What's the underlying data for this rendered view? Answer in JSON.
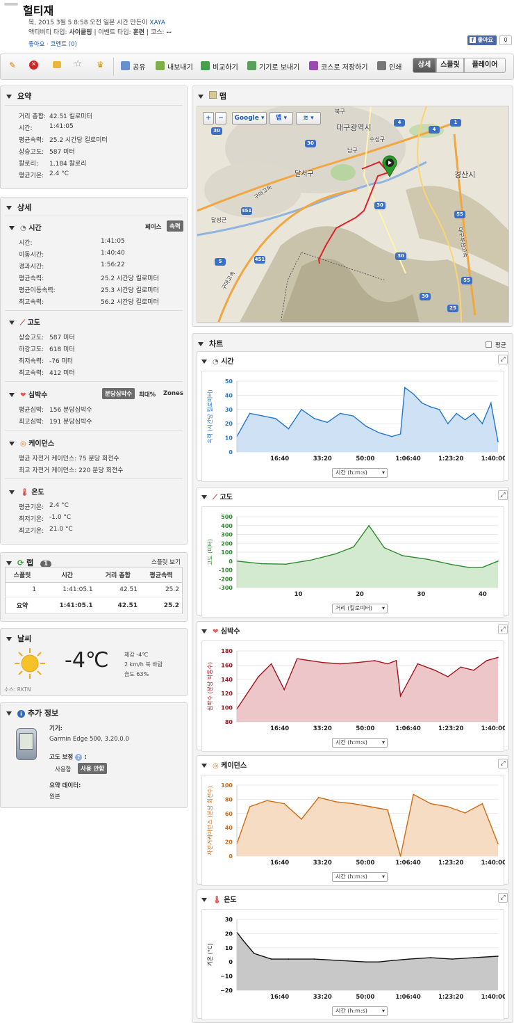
{
  "header": {
    "title": "헐티재",
    "date_line_prefix": "목, 2015 3월 5 8:58 오전 일본 시간 만든이",
    "author": "XAYA",
    "activity_type_label": "액티비티 타입:",
    "activity_type": "사이클링",
    "event_type_label": "| 이벤트 타입:",
    "event_type": "훈련",
    "course_label": "| 코스:",
    "course": "--",
    "like_link": "좋아요",
    "comment_link": "코멘트 (0)",
    "dot": "·",
    "fb_like": "좋아요",
    "fb_count": "0"
  },
  "toolbar": {
    "share": "공유",
    "export": "내보내기",
    "compare": "비교하기",
    "send_to_device": "기기로 보내기",
    "save_course": "코스로 저장하기",
    "print": "인쇄",
    "view_tabs": [
      "상세",
      "스플릿",
      "플레이어"
    ]
  },
  "summary": {
    "title": "요약",
    "rows": [
      {
        "label": "거리 총합:",
        "value": "42.51 킬로미터"
      },
      {
        "label": "시간:",
        "value": "1:41:05"
      },
      {
        "label": "평균속력:",
        "value": "25.2 시간당 킬로미터"
      },
      {
        "label": "상승고도:",
        "value": "587 미터"
      },
      {
        "label": "칼로리:",
        "value": "1,184 칼로리"
      },
      {
        "label": "평균기온:",
        "value": "2.4 °C"
      }
    ]
  },
  "details": {
    "title": "상세",
    "time": {
      "title": "시간",
      "toggle": [
        "페이스",
        "속력"
      ],
      "rows": [
        {
          "label": "시간:",
          "value": "1:41:05"
        },
        {
          "label": "이동시간:",
          "value": "1:40:40"
        },
        {
          "label": "경과시간:",
          "value": "1:56:22"
        },
        {
          "label": "평균속력:",
          "value": "25.2 시간당 킬로미터"
        },
        {
          "label": "평균이동속력:",
          "value": "25.3 시간당 킬로미터"
        },
        {
          "label": "최고속력:",
          "value": "56.2 시간당 킬로미터"
        }
      ]
    },
    "elevation": {
      "title": "고도",
      "rows": [
        {
          "label": "상승고도:",
          "value": "587 미터"
        },
        {
          "label": "하강고도:",
          "value": "618 미터"
        },
        {
          "label": "최저속력:",
          "value": "-76 미터"
        },
        {
          "label": "최고속력:",
          "value": "412 미터"
        }
      ]
    },
    "heart": {
      "title": "심박수",
      "toggle": [
        "분당심박수",
        "최대%",
        "Zones"
      ],
      "rows": [
        {
          "label": "평균심박:",
          "value": "156 분당심박수"
        },
        {
          "label": "최고심박:",
          "value": "191 분당심박수"
        }
      ]
    },
    "cadence": {
      "title": "케이던스",
      "rows": [
        {
          "label": "평균 자전거 케이던스:",
          "value": "75 분당 회전수"
        },
        {
          "label": "최고 자전거 케이던스:",
          "value": "220 분당 회전수"
        }
      ]
    },
    "temperature": {
      "title": "온도",
      "rows": [
        {
          "label": "평균기온:",
          "value": "2.4 °C"
        },
        {
          "label": "최저기온:",
          "value": "-1.0 °C"
        },
        {
          "label": "최고기온:",
          "value": "21.0 °C"
        }
      ]
    }
  },
  "laps": {
    "title": "랩",
    "count": "1",
    "view_splits": "스플릿 보기",
    "columns": [
      "스플릿",
      "시간",
      "거리 총합",
      "평균속력"
    ],
    "rows": [
      [
        "1",
        "1:41:05.1",
        "42.51",
        "25.2"
      ],
      [
        "요약",
        "1:41:05.1",
        "42.51",
        "25.2"
      ]
    ]
  },
  "weather": {
    "title": "날씨",
    "temp": "-4℃",
    "feels": "체감 -4℃",
    "wind": "2 km/h 북 바람",
    "humidity": "습도 63%",
    "source": "소스: RKTN"
  },
  "extra": {
    "title": "추가 정보",
    "device_label": "기기:",
    "device": "Garmin Edge 500, 3.20.0.0",
    "elev_corr_label": "고도 보정",
    "elev_corr_suffix": ":",
    "elev_corr_options": [
      "사용함",
      "사용 안함"
    ],
    "summary_data_label": "요약 데이터:",
    "summary_data": "원본"
  },
  "map": {
    "title": "맵",
    "plus": "+",
    "minus": "−",
    "provider": "Google",
    "map_type": "맵",
    "labels": [
      "대구광역시",
      "경산시",
      "달서구",
      "수성구",
      "남구",
      "북구",
      "달성군",
      "구마고속",
      "구마고속",
      "대구부산고속"
    ],
    "route_color": "#e0202a"
  },
  "charts": {
    "title": "차트",
    "average_label": "평균",
    "time": {
      "title": "시간",
      "ylabel": "속력 (시간당 킬로미터)",
      "xsel": "시간 (h:m:s)",
      "color": "#2277cc",
      "fill": "#cfe1f5",
      "yticks": [
        "50",
        "40",
        "30",
        "20",
        "10",
        "0"
      ],
      "xticks": [
        "16:40",
        "33:20",
        "50:00",
        "1:06:40",
        "1:23:20",
        "1:40:00"
      ]
    },
    "elevation": {
      "title": "고도",
      "ylabel": "고도 (미터)",
      "xsel": "거리 (킬로미터)",
      "color": "#2d8a2d",
      "fill": "#d4ead0",
      "yticks": [
        "500",
        "400",
        "300",
        "200",
        "100",
        "0",
        "-100",
        "-200",
        "-300"
      ],
      "xticks": [
        "10",
        "20",
        "30",
        "40"
      ]
    },
    "heart": {
      "title": "심박수",
      "ylabel": "심박수 (분당 박동수)",
      "xsel": "시간 (h:m:s)",
      "color": "#a0141c",
      "fill": "#ecc6c8",
      "yticks": [
        "180",
        "160",
        "140",
        "120",
        "100",
        "80"
      ],
      "xticks": [
        "16:40",
        "33:20",
        "50:00",
        "1:06:40",
        "1:23:20",
        "1:40:00"
      ]
    },
    "cadence": {
      "title": "케이던스",
      "ylabel": "자전거케이던스 (분당 회전수)",
      "xsel": "시간 (h:m:s)",
      "color": "#d06a10",
      "fill": "#f7dcc4",
      "yticks": [
        "100",
        "80",
        "60",
        "40",
        "20",
        "0"
      ],
      "xticks": [
        "16:40",
        "33:20",
        "50:00",
        "1:06:40",
        "1:23:20",
        "1:40:00"
      ]
    },
    "temperature": {
      "title": "온도",
      "ylabel": "기온 (°C)",
      "xsel": "시간 (h:m:s)",
      "color": "#111111",
      "fill": "#c8c8c8",
      "yticks": [
        "30",
        "20",
        "10",
        "0",
        "−10",
        "−20"
      ],
      "xticks": [
        "16:40",
        "33:20",
        "50:00",
        "1:06:40",
        "1:23:20",
        "1:40:00"
      ]
    }
  },
  "chart_data": [
    {
      "type": "area",
      "title": "시간",
      "ylabel": "속력 (시간당 킬로미터)",
      "xlabel": "시간 (h:m:s)",
      "ylim": [
        0,
        55
      ],
      "xlim": [
        0,
        6065
      ],
      "x": [
        0,
        300,
        600,
        900,
        1200,
        1500,
        1800,
        2100,
        2400,
        2700,
        3000,
        3300,
        3600,
        3800,
        3900,
        4100,
        4300,
        4500,
        4700,
        4900,
        5100,
        5300,
        5500,
        5700,
        5900,
        6065
      ],
      "y": [
        12,
        30,
        28,
        26,
        18,
        33,
        26,
        23,
        30,
        28,
        20,
        15,
        12,
        14,
        50,
        45,
        38,
        35,
        33,
        22,
        30,
        25,
        30,
        22,
        38,
        8
      ]
    },
    {
      "type": "area",
      "title": "고도",
      "ylabel": "고도 (미터)",
      "xlabel": "거리 (킬로미터)",
      "ylim": [
        -300,
        500
      ],
      "xlim": [
        0,
        42.5
      ],
      "x": [
        0,
        4,
        8,
        12,
        16,
        19,
        21.5,
        24,
        27,
        31,
        35,
        38,
        40,
        42.5
      ],
      "y": [
        0,
        -30,
        -35,
        10,
        80,
        160,
        400,
        150,
        60,
        20,
        -40,
        -75,
        -70,
        0
      ]
    },
    {
      "type": "area",
      "title": "심박수",
      "ylabel": "심박수 (분당 박동수)",
      "xlabel": "시간 (h:m:s)",
      "ylim": [
        80,
        190
      ],
      "xlim": [
        0,
        6065
      ],
      "x": [
        0,
        200,
        500,
        800,
        1100,
        1400,
        1700,
        2000,
        2400,
        2800,
        3200,
        3500,
        3700,
        3800,
        4200,
        4600,
        4900,
        5200,
        5500,
        5800,
        6065
      ],
      "y": [
        100,
        120,
        150,
        170,
        130,
        178,
        175,
        172,
        170,
        172,
        175,
        170,
        175,
        120,
        170,
        160,
        150,
        165,
        160,
        175,
        180
      ]
    },
    {
      "type": "area",
      "title": "케이던스",
      "ylabel": "자전거케이던스 (분당 회전수)",
      "xlabel": "시간 (h:m:s)",
      "ylim": [
        0,
        115
      ],
      "xlim": [
        0,
        6065
      ],
      "x": [
        0,
        300,
        700,
        1100,
        1500,
        1900,
        2300,
        2700,
        3100,
        3500,
        3800,
        4100,
        4500,
        4900,
        5300,
        5700,
        6065
      ],
      "y": [
        20,
        80,
        90,
        85,
        60,
        95,
        88,
        85,
        80,
        75,
        0,
        100,
        85,
        80,
        70,
        85,
        20
      ]
    },
    {
      "type": "area",
      "title": "온도",
      "ylabel": "기온 (°C)",
      "xlabel": "시간 (h:m:s)",
      "ylim": [
        -20,
        30
      ],
      "xlim": [
        0,
        6065
      ],
      "x": [
        0,
        150,
        400,
        800,
        1200,
        1800,
        2400,
        3000,
        3300,
        3600,
        4000,
        4500,
        5000,
        5500,
        6065
      ],
      "y": [
        21,
        15,
        6,
        2,
        2,
        2,
        1,
        0,
        0,
        1,
        2,
        3,
        2,
        3,
        4
      ]
    }
  ]
}
